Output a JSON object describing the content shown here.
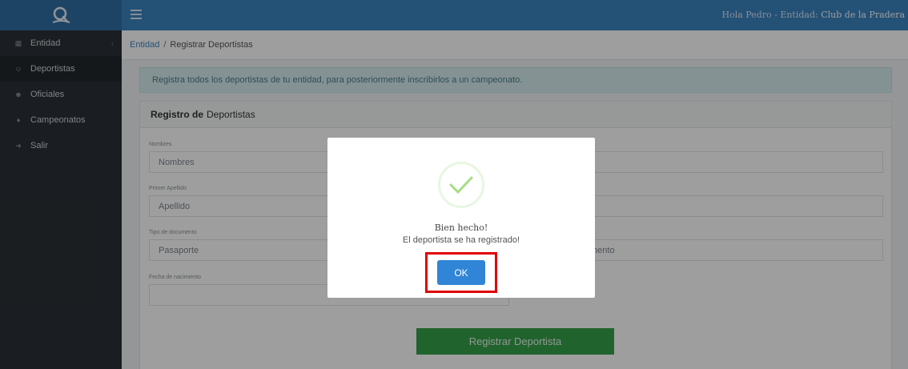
{
  "topbar": {
    "greeting": "Hola Pedro - Entidad:",
    "entity": "Club de la Pradera"
  },
  "sidebar": {
    "items": [
      {
        "label": "Entidad",
        "icon": "building-icon"
      },
      {
        "label": "Deportistas",
        "icon": "users-icon"
      },
      {
        "label": "Oficiales",
        "icon": "user-icon"
      },
      {
        "label": "Campeonatos",
        "icon": "trophy-icon"
      },
      {
        "label": "Salir",
        "icon": "logout-icon"
      }
    ]
  },
  "breadcrumb": {
    "link": "Entidad",
    "separator": "/",
    "current": "Registrar Deportistas"
  },
  "alert": {
    "text": "Registra todos los deportistas de tu entidad, para posteriormente inscribirlos a un campeonato."
  },
  "form": {
    "header_bold": "Registro de",
    "header_rest": "Deportistas",
    "nombres_label": "Nombres",
    "nombres_placeholder": "Nombres",
    "apellido_label": "Primer Apellido",
    "apellido_placeholder": "Apellido",
    "tipo_doc_label": "Tipo de documento",
    "tipo_doc_value": "Pasaporte",
    "num_doc_partial": "mento",
    "fecha_label": "Fecha de nacimiento",
    "submit_label": "Registrar Deportista"
  },
  "modal": {
    "title": "Bien hecho!",
    "text": "El deportista se ha registrado!",
    "ok_label": "OK"
  },
  "colors": {
    "topbar": "#3b84be",
    "sidebar": "#2b3036",
    "submit": "#36a14a",
    "ok_button": "#3085d6",
    "highlight": "#e00000"
  }
}
